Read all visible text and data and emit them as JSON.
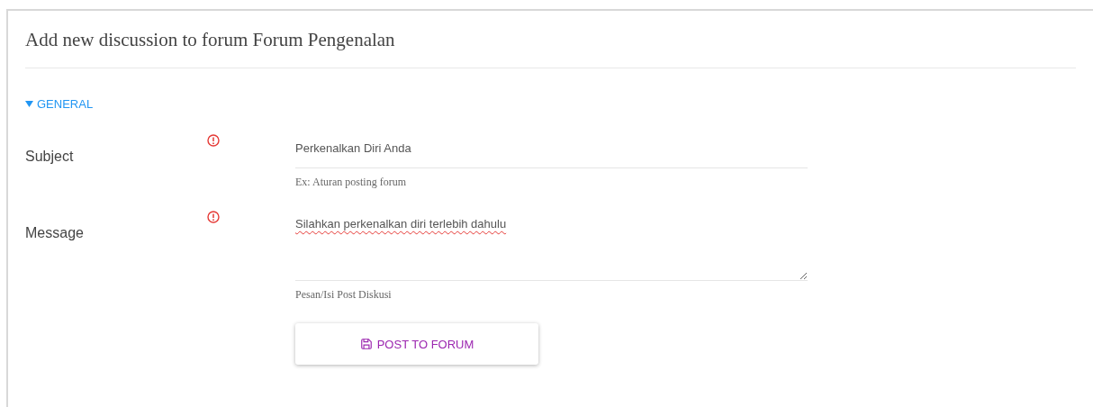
{
  "title": "Add new discussion to forum Forum Pengenalan",
  "section": {
    "label": "GENERAL",
    "expanded": true
  },
  "fields": [
    {
      "kind": "text",
      "label": "Subject",
      "required": true,
      "value": "Perkenalkan Diri Anda",
      "help": "Ex: Aturan posting forum"
    },
    {
      "kind": "textarea",
      "label": "Message",
      "required": true,
      "value": "Silahkan perkenalkan diri terlebih dahulu",
      "help": "Pesan/Isi Post Diskusi"
    }
  ],
  "submit": {
    "label": "POST TO FORUM"
  }
}
